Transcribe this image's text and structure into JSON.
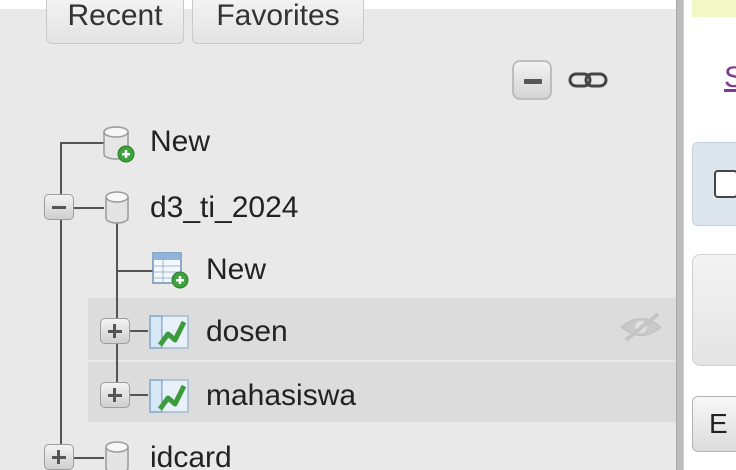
{
  "nav": {
    "tabs": {
      "recent": "Recent",
      "favorites": "Favorites"
    },
    "controls": {
      "collapse_icon": "collapse-all-icon",
      "link_icon": "link-with-main-panel-icon"
    },
    "tree": {
      "new_server": "New",
      "database": "d3_ti_2024",
      "new_table": "New",
      "tables": [
        "dosen",
        "mahasiswa"
      ],
      "next_database": "idcard"
    }
  },
  "main": {
    "link_partial": "S",
    "button_partial": "E"
  },
  "colors": {
    "nav_bg": "#e9e9e9",
    "row_highlight": "#dcdcdc",
    "link_color": "#7a3d8c",
    "panel_blue": "#dde6ef",
    "table_icon_green": "#3c9c3c"
  }
}
